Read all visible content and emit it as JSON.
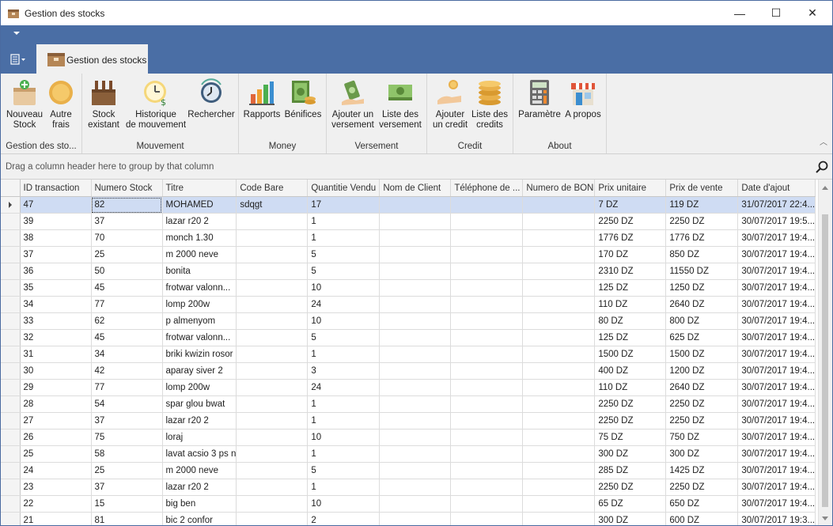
{
  "window": {
    "title": "Gestion des stocks",
    "minimize": "—",
    "maximize": "☐",
    "close": "✕"
  },
  "tab": {
    "label": "Gestion des stocks"
  },
  "ribbon": {
    "groups": [
      {
        "label": "Gestion des sto...",
        "buttons": [
          {
            "line1": "Nouveau",
            "line2": "Stock"
          },
          {
            "line1": "Autre",
            "line2": "frais"
          }
        ]
      },
      {
        "label": "Mouvement",
        "buttons": [
          {
            "line1": "Stock",
            "line2": "existant"
          },
          {
            "line1": "Historique",
            "line2": "de mouvement"
          },
          {
            "line1": "Rechercher",
            "line2": ""
          }
        ]
      },
      {
        "label": "Money",
        "buttons": [
          {
            "line1": "Rapports",
            "line2": ""
          },
          {
            "line1": "Bénifices",
            "line2": ""
          }
        ]
      },
      {
        "label": "Versement",
        "buttons": [
          {
            "line1": "Ajouter un",
            "line2": "versement"
          },
          {
            "line1": "Liste des",
            "line2": "versement"
          }
        ]
      },
      {
        "label": "Credit",
        "buttons": [
          {
            "line1": "Ajouter",
            "line2": "un credit"
          },
          {
            "line1": "Liste des",
            "line2": "credits"
          }
        ]
      },
      {
        "label": "About",
        "buttons": [
          {
            "line1": "Paramètre",
            "line2": ""
          },
          {
            "line1": "A propos",
            "line2": ""
          }
        ]
      }
    ]
  },
  "grid": {
    "group_panel_text": "Drag a column header here to group by that column",
    "columns": [
      "ID transaction",
      "Numero Stock",
      "Titre",
      "Code Bare",
      "Quantitie Vendu",
      "Nom de Client",
      "Téléphone de ...",
      "Numero de BON",
      "Prix unitaire",
      "Prix de vente",
      "Date d'ajout"
    ],
    "rows": [
      [
        "47",
        "82",
        "MOHAMED",
        "sdqgt",
        "17",
        "",
        "",
        "",
        "7 DZ",
        "119 DZ",
        "31/07/2017 22:4..."
      ],
      [
        "39",
        "37",
        "lazar r20 2",
        "",
        "1",
        "",
        "",
        "",
        "2250 DZ",
        "2250 DZ",
        "30/07/2017 19:5..."
      ],
      [
        "38",
        "70",
        "monch 1.30",
        "",
        "1",
        "",
        "",
        "",
        "1776 DZ",
        "1776 DZ",
        "30/07/2017 19:4..."
      ],
      [
        "37",
        "25",
        "m 2000 neve",
        "",
        "5",
        "",
        "",
        "",
        "170 DZ",
        "850 DZ",
        "30/07/2017 19:4..."
      ],
      [
        "36",
        "50",
        "bonita",
        "",
        "5",
        "",
        "",
        "",
        "2310 DZ",
        "11550 DZ",
        "30/07/2017 19:4..."
      ],
      [
        "35",
        "45",
        "frotwar valonn...",
        "",
        "10",
        "",
        "",
        "",
        "125 DZ",
        "1250 DZ",
        "30/07/2017 19:4..."
      ],
      [
        "34",
        "77",
        "lomp 200w",
        "",
        "24",
        "",
        "",
        "",
        "110 DZ",
        "2640 DZ",
        "30/07/2017 19:4..."
      ],
      [
        "33",
        "62",
        "p almenyom",
        "",
        "10",
        "",
        "",
        "",
        "80 DZ",
        "800 DZ",
        "30/07/2017 19:4..."
      ],
      [
        "32",
        "45",
        "frotwar valonn...",
        "",
        "5",
        "",
        "",
        "",
        "125 DZ",
        "625 DZ",
        "30/07/2017 19:4..."
      ],
      [
        "31",
        "34",
        "briki kwizin rosor",
        "",
        "1",
        "",
        "",
        "",
        "1500 DZ",
        "1500 DZ",
        "30/07/2017 19:4..."
      ],
      [
        "30",
        "42",
        "aparay siver 2",
        "",
        "3",
        "",
        "",
        "",
        "400 DZ",
        "1200 DZ",
        "30/07/2017 19:4..."
      ],
      [
        "29",
        "77",
        "lomp 200w",
        "",
        "24",
        "",
        "",
        "",
        "110 DZ",
        "2640 DZ",
        "30/07/2017 19:4..."
      ],
      [
        "28",
        "54",
        "spar glou bwat",
        "",
        "1",
        "",
        "",
        "",
        "2250 DZ",
        "2250 DZ",
        "30/07/2017 19:4..."
      ],
      [
        "27",
        "37",
        "lazar r20 2",
        "",
        "1",
        "",
        "",
        "",
        "2250 DZ",
        "2250 DZ",
        "30/07/2017 19:4..."
      ],
      [
        "26",
        "75",
        "loraj",
        "",
        "10",
        "",
        "",
        "",
        "75 DZ",
        "750 DZ",
        "30/07/2017 19:4..."
      ],
      [
        "25",
        "58",
        "lavat acsio 3 ps n",
        "",
        "1",
        "",
        "",
        "",
        "300 DZ",
        "300 DZ",
        "30/07/2017 19:4..."
      ],
      [
        "24",
        "25",
        "m 2000 neve",
        "",
        "5",
        "",
        "",
        "",
        "285 DZ",
        "1425 DZ",
        "30/07/2017 19:4..."
      ],
      [
        "23",
        "37",
        "lazar r20 2",
        "",
        "1",
        "",
        "",
        "",
        "2250 DZ",
        "2250 DZ",
        "30/07/2017 19:4..."
      ],
      [
        "22",
        "15",
        "big ben",
        "",
        "10",
        "",
        "",
        "",
        "65 DZ",
        "650 DZ",
        "30/07/2017 19:4..."
      ],
      [
        "21",
        "81",
        "bic 2 confor",
        "",
        "2",
        "",
        "",
        "",
        "300 DZ",
        "600 DZ",
        "30/07/2017 19:3..."
      ]
    ]
  },
  "colors": {
    "accent": "#4a6ea5",
    "selection": "#cfdcf3"
  }
}
